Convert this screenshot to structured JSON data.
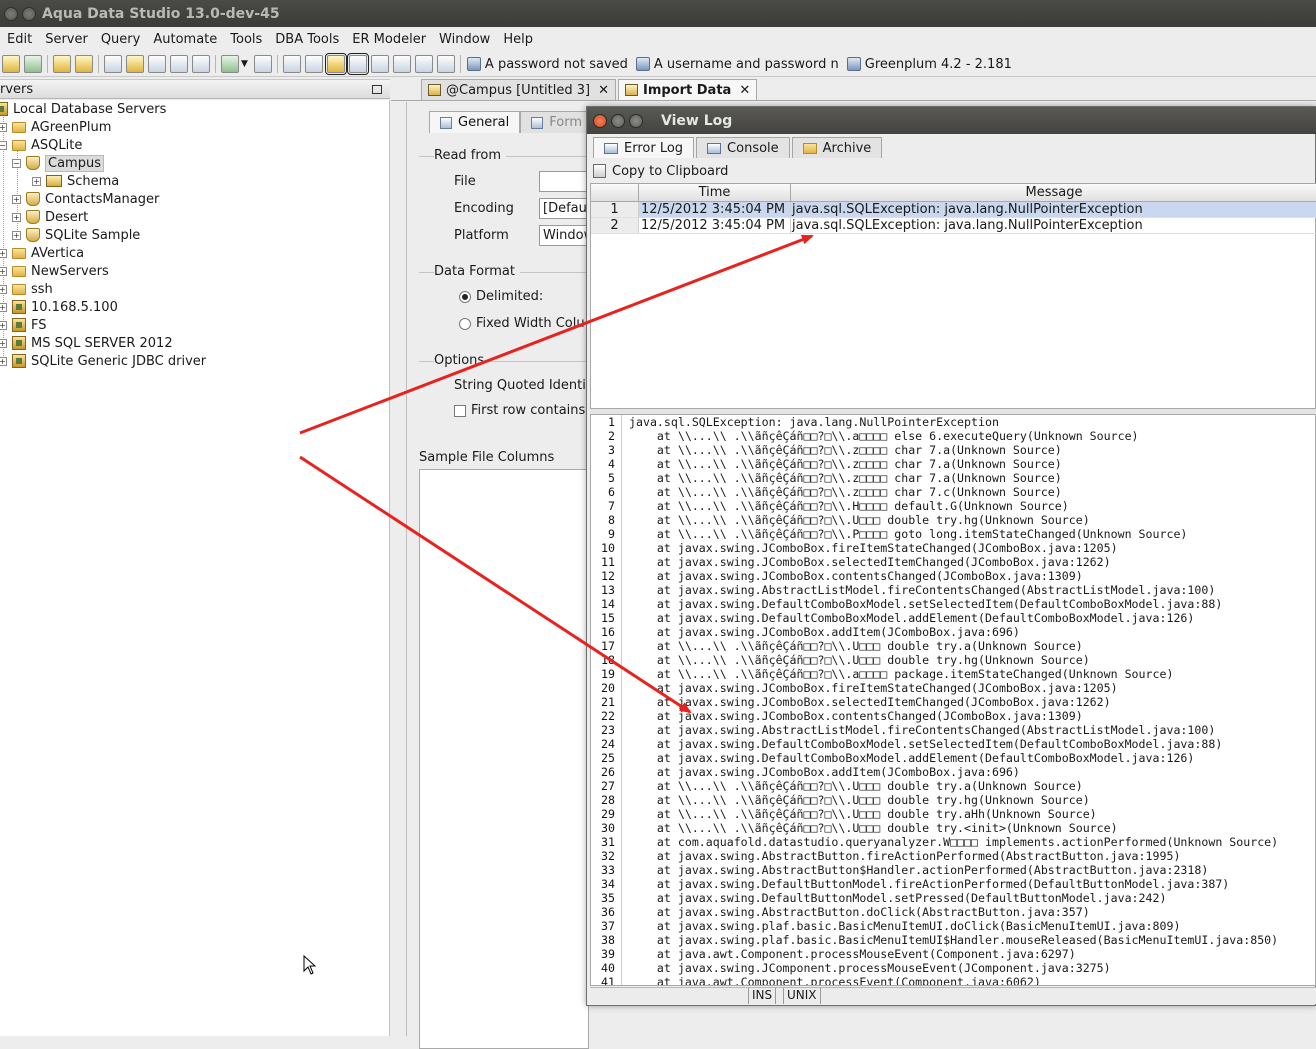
{
  "window": {
    "title": "Aqua Data Studio 13.0-dev-45"
  },
  "menu": [
    "Edit",
    "Server",
    "Query",
    "Automate",
    "Tools",
    "DBA Tools",
    "ER Modeler",
    "Window",
    "Help"
  ],
  "toolbar_conn": [
    {
      "label": "A password not saved",
      "icon": "connection-icon"
    },
    {
      "label": "A username and password n",
      "icon": "connection-icon"
    },
    {
      "label": "Greenplum 4.2 - 2.181",
      "icon": "connection-icon"
    }
  ],
  "left_panel": {
    "header": "rvers"
  },
  "tree": [
    {
      "label": "Local Database Servers",
      "icon": "servers-icon",
      "level": 0
    },
    {
      "label": "AGreenPlum",
      "icon": "folder-icon",
      "level": 1
    },
    {
      "label": "ASQLite",
      "icon": "folder-icon",
      "level": 1
    },
    {
      "label": "Campus",
      "icon": "database-icon",
      "level": 2
    },
    {
      "label": "Schema",
      "icon": "schema-icon",
      "level": 3
    },
    {
      "label": "ContactsManager",
      "icon": "database-icon",
      "level": 2
    },
    {
      "label": "Desert",
      "icon": "database-icon",
      "level": 2
    },
    {
      "label": "SQLite Sample",
      "icon": "database-icon",
      "level": 2
    },
    {
      "label": "AVertica",
      "icon": "folder-icon",
      "level": 1
    },
    {
      "label": "NewServers",
      "icon": "folder-icon",
      "level": 1
    },
    {
      "label": "ssh",
      "icon": "folder-icon",
      "level": 1
    },
    {
      "label": "10.168.5.100",
      "icon": "server-icon",
      "level": 1
    },
    {
      "label": "FS",
      "icon": "server-icon",
      "level": 1
    },
    {
      "label": "MS SQL SERVER 2012",
      "icon": "server-icon",
      "level": 1
    },
    {
      "label": "SQLite Generic JDBC driver",
      "icon": "server-icon",
      "level": 1
    }
  ],
  "tabs": [
    {
      "label": "@Campus [Untitled 3]"
    },
    {
      "label": "Import Data"
    }
  ],
  "import": {
    "subtabs": [
      "General",
      "Form"
    ],
    "read_from": "Read from",
    "file_label": "File",
    "file_value": "",
    "encoding_label": "Encoding",
    "encoding_value": "[Defaul",
    "platform_label": "Platform",
    "platform_value": "Window",
    "data_format": "Data Format",
    "delimited": "Delimited:",
    "fixed_width": "Fixed Width Colu",
    "options": "Options",
    "string_quoted": "String Quoted Identifi",
    "first_row": "First row contains",
    "sample": "Sample File Columns"
  },
  "dialog": {
    "title": "View Log",
    "tabs": [
      "Error Log",
      "Console",
      "Archive"
    ],
    "copy": "Copy to Clipboard",
    "columns": [
      "Time",
      "Message"
    ],
    "rows": [
      {
        "n": "1",
        "time": "12/5/2012 3:45:04 PM",
        "msg": "java.sql.SQLException: java.lang.NullPointerException"
      },
      {
        "n": "2",
        "time": "12/5/2012 3:45:04 PM",
        "msg": "java.sql.SQLException: java.lang.NullPointerException"
      }
    ],
    "stack": [
      "java.sql.SQLException: java.lang.NullPointerException",
      "    at \\\\...\\\\ .\\\\ãñçêÇáñ□□?□\\\\.a□□□□ else 6.executeQuery(Unknown Source)",
      "    at \\\\...\\\\ .\\\\ãñçêÇáñ□□?□\\\\.z□□□□ char 7.a(Unknown Source)",
      "    at \\\\...\\\\ .\\\\ãñçêÇáñ□□?□\\\\.z□□□□ char 7.a(Unknown Source)",
      "    at \\\\...\\\\ .\\\\ãñçêÇáñ□□?□\\\\.z□□□□ char 7.a(Unknown Source)",
      "    at \\\\...\\\\ .\\\\ãñçêÇáñ□□?□\\\\.z□□□□ char 7.c(Unknown Source)",
      "    at \\\\...\\\\ .\\\\ãñçêÇáñ□□?□\\\\.H□□□□ default.G(Unknown Source)",
      "    at \\\\...\\\\ .\\\\ãñçêÇáñ□□?□\\\\.U□□□ double try.hg(Unknown Source)",
      "    at \\\\...\\\\ .\\\\ãñçêÇáñ□□?□\\\\.P□□□□ goto long.itemStateChanged(Unknown Source)",
      "    at javax.swing.JComboBox.fireItemStateChanged(JComboBox.java:1205)",
      "    at javax.swing.JComboBox.selectedItemChanged(JComboBox.java:1262)",
      "    at javax.swing.JComboBox.contentsChanged(JComboBox.java:1309)",
      "    at javax.swing.AbstractListModel.fireContentsChanged(AbstractListModel.java:100)",
      "    at javax.swing.DefaultComboBoxModel.setSelectedItem(DefaultComboBoxModel.java:88)",
      "    at javax.swing.DefaultComboBoxModel.addElement(DefaultComboBoxModel.java:126)",
      "    at javax.swing.JComboBox.addItem(JComboBox.java:696)",
      "    at \\\\...\\\\ .\\\\ãñçêÇáñ□□?□\\\\.U□□□ double try.a(Unknown Source)",
      "    at \\\\...\\\\ .\\\\ãñçêÇáñ□□?□\\\\.U□□□ double try.hg(Unknown Source)",
      "    at \\\\...\\\\ .\\\\ãñçêÇáñ□□?□\\\\.a□□□□ package.itemStateChanged(Unknown Source)",
      "    at javax.swing.JComboBox.fireItemStateChanged(JComboBox.java:1205)",
      "    at javax.swing.JComboBox.selectedItemChanged(JComboBox.java:1262)",
      "    at javax.swing.JComboBox.contentsChanged(JComboBox.java:1309)",
      "    at javax.swing.AbstractListModel.fireContentsChanged(AbstractListModel.java:100)",
      "    at javax.swing.DefaultComboBoxModel.setSelectedItem(DefaultComboBoxModel.java:88)",
      "    at javax.swing.DefaultComboBoxModel.addElement(DefaultComboBoxModel.java:126)",
      "    at javax.swing.JComboBox.addItem(JComboBox.java:696)",
      "    at \\\\...\\\\ .\\\\ãñçêÇáñ□□?□\\\\.U□□□ double try.a(Unknown Source)",
      "    at \\\\...\\\\ .\\\\ãñçêÇáñ□□?□\\\\.U□□□ double try.hg(Unknown Source)",
      "    at \\\\...\\\\ .\\\\ãñçêÇáñ□□?□\\\\.U□□□ double try.aHh(Unknown Source)",
      "    at \\\\...\\\\ .\\\\ãñçêÇáñ□□?□\\\\.U□□□ double try.<init>(Unknown Source)",
      "    at com.aquafold.datastudio.queryanalyzer.W□□□□ implements.actionPerformed(Unknown Source)",
      "    at javax.swing.AbstractButton.fireActionPerformed(AbstractButton.java:1995)",
      "    at javax.swing.AbstractButton$Handler.actionPerformed(AbstractButton.java:2318)",
      "    at javax.swing.DefaultButtonModel.fireActionPerformed(DefaultButtonModel.java:387)",
      "    at javax.swing.DefaultButtonModel.setPressed(DefaultButtonModel.java:242)",
      "    at javax.swing.AbstractButton.doClick(AbstractButton.java:357)",
      "    at javax.swing.plaf.basic.BasicMenuItemUI.doClick(BasicMenuItemUI.java:809)",
      "    at javax.swing.plaf.basic.BasicMenuItemUI$Handler.mouseReleased(BasicMenuItemUI.java:850)",
      "    at java.awt.Component.processMouseEvent(Component.java:6297)",
      "    at javax.swing.JComponent.processMouseEvent(JComponent.java:3275)",
      "    at java.awt.Component.processEvent(Component.java:6062)"
    ],
    "status": [
      "INS",
      "UNIX"
    ]
  },
  "colors": {
    "accent": "#c9d8ee",
    "annotation": "#e8231f"
  }
}
